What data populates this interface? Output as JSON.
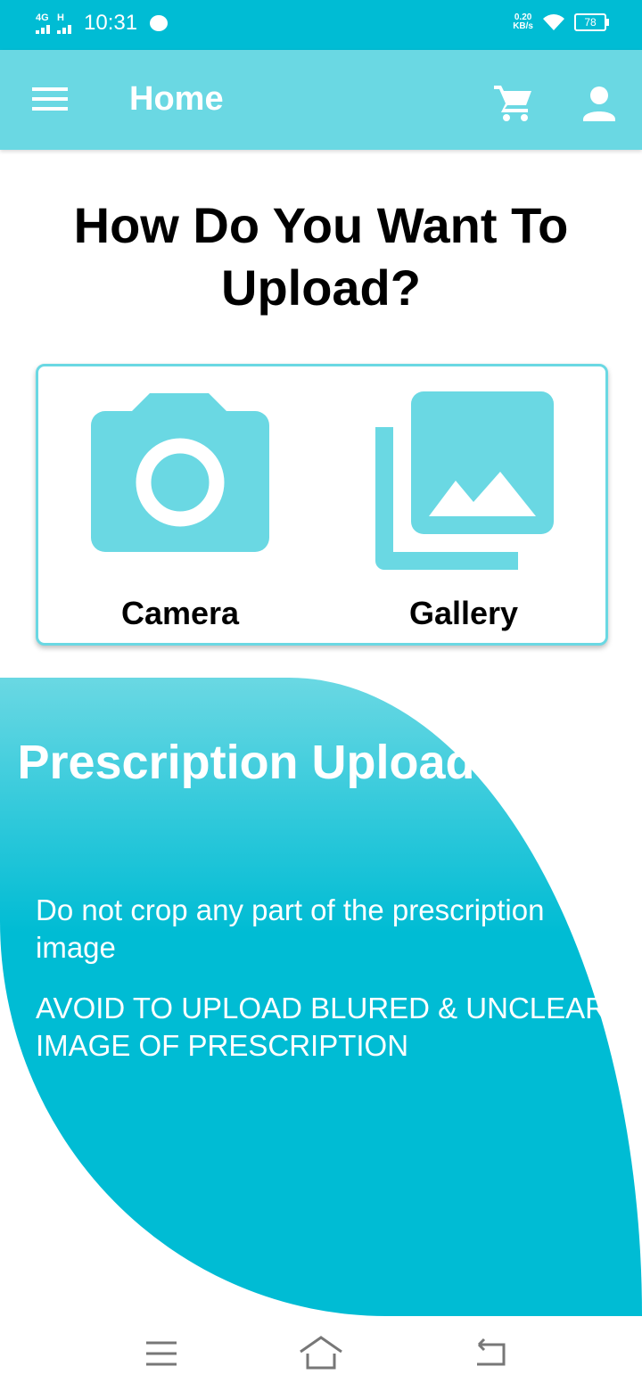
{
  "status_bar": {
    "network1": "4G",
    "network2": "H",
    "time": "10:31",
    "speed_value": "0.20",
    "speed_unit": "KB/s",
    "battery": "78"
  },
  "app_bar": {
    "title": "Home",
    "icons": [
      "menu-icon",
      "cart-icon",
      "profile-icon"
    ]
  },
  "main": {
    "heading": "How Do You Want To Upload?",
    "options": [
      {
        "label": "Camera",
        "icon": "camera-icon"
      },
      {
        "label": "Gallery",
        "icon": "gallery-icon"
      }
    ]
  },
  "guide": {
    "title": "Prescription Upload Guide",
    "tips": [
      "Do not crop any part of the prescription image",
      "AVOID TO UPLOAD BLURED & UNCLEAR IMAGE OF PRESCRIPTION"
    ]
  },
  "colors": {
    "primary": "#00bcd4",
    "primary_light": "#6ad8e3"
  },
  "nav_bar": {
    "icons": [
      "recents-icon",
      "home-icon",
      "back-icon"
    ]
  }
}
